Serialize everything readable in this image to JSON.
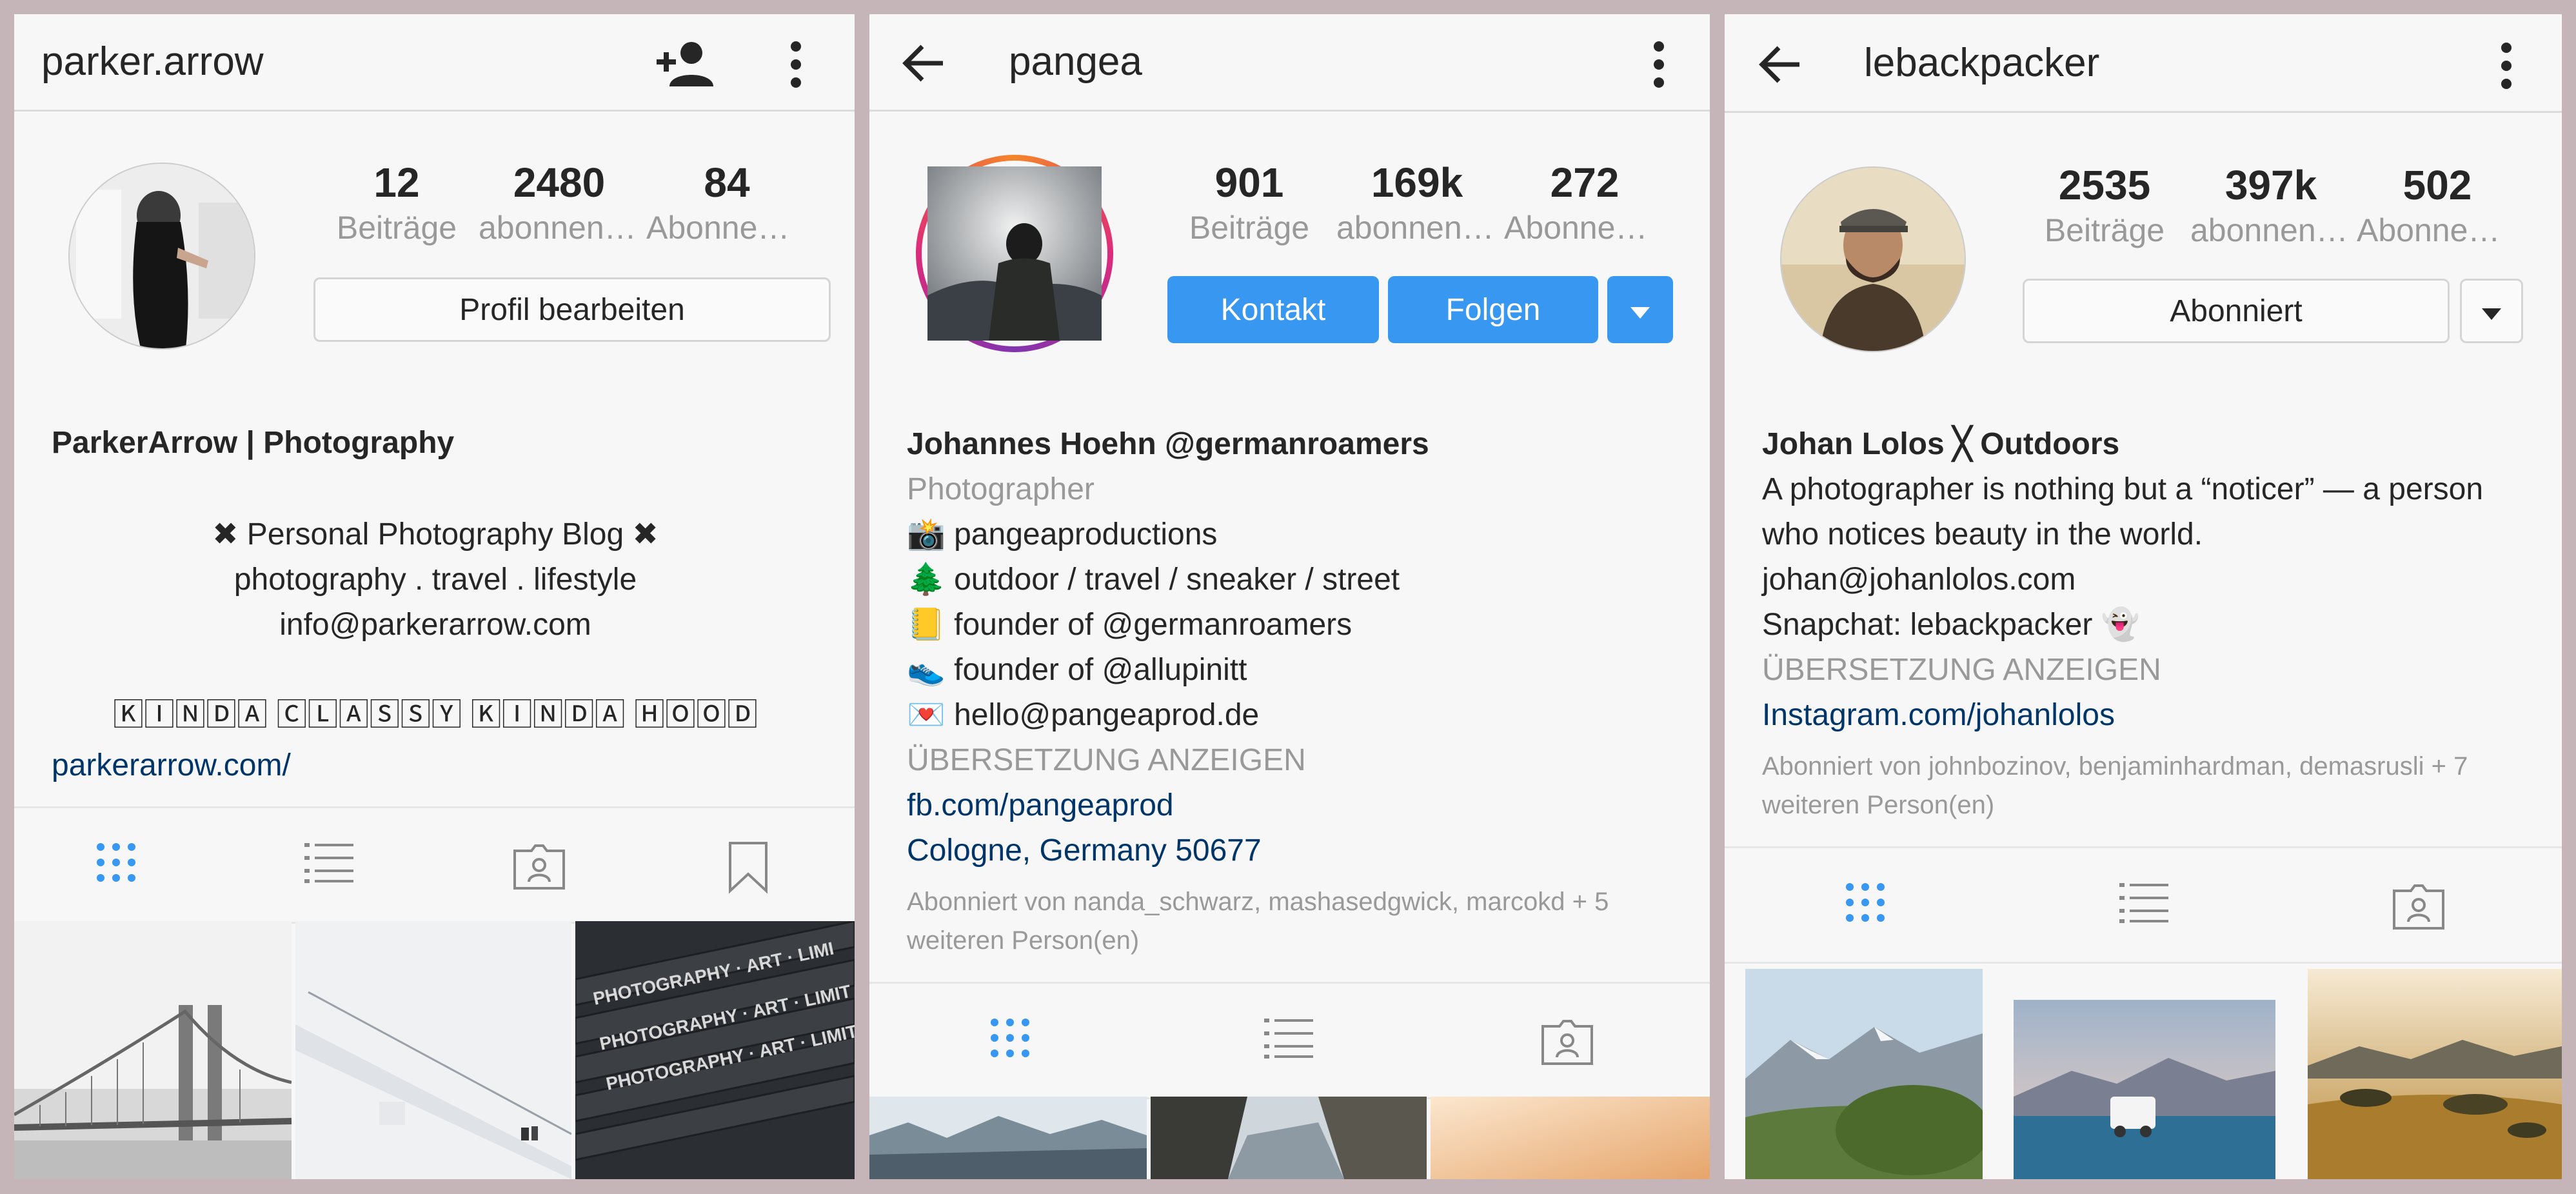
{
  "panels": [
    {
      "username": "parker.arrow",
      "stats": [
        {
          "num": "12",
          "label": "Beiträge"
        },
        {
          "num": "2480",
          "label": "abonnent..."
        },
        {
          "num": "84",
          "label": "Abonnem..."
        }
      ],
      "edit_button": "Profil bearbeiten",
      "bio_name": "ParkerArrow | Photography",
      "bio_lines": [
        "✖ Personal Photography Blog ✖",
        "photography . travel . lifestyle",
        "info@parkerarrow.com"
      ],
      "bio_tagline": "🄺🄸🄽🄳🄰 🄲🄻🄰🅂🅂🅈 🄺🄸🄽🄳🄰 🄷🄾🄾🄳",
      "link": "parkerarrow.com/",
      "icons": [
        "add-person-icon",
        "more-vertical-icon",
        "grid-icon",
        "list-icon",
        "tagged-icon",
        "bookmark-icon"
      ]
    },
    {
      "username": "pangea",
      "stats": [
        {
          "num": "901",
          "label": "Beiträge"
        },
        {
          "num": "169k",
          "label": "abonnent..."
        },
        {
          "num": "272",
          "label": "Abonnem..."
        }
      ],
      "contact_button": "Kontakt",
      "follow_button": "Folgen",
      "bio_name": "Johannes Hoehn @germanroamers",
      "category": "Photographer",
      "bio_lines": [
        "📸 pangeaproductions",
        "🌲 outdoor / travel / sneaker / street",
        "📒 founder of @germanroamers",
        "👟 founder of @allupinitt",
        "💌 hello@pangeaprod.de"
      ],
      "translate": "ÜBERSETZUNG ANZEIGEN",
      "link": "fb.com/pangeaprod",
      "location": "Cologne, Germany 50677",
      "followed_by": "Abonniert von nanda_schwarz, mashasedgwick, marcokd + 5 weiteren Person(en)"
    },
    {
      "username": "lebackpacker",
      "stats": [
        {
          "num": "2535",
          "label": "Beiträge"
        },
        {
          "num": "397k",
          "label": "abonnent..."
        },
        {
          "num": "502",
          "label": "Abonnem..."
        }
      ],
      "subscribed_button": "Abonniert",
      "bio_name": "Johan Lolos ╳ Outdoors",
      "bio_lines": [
        "A photographer is nothing but a “noticer” — a person who notices beauty in the world.",
        "johan@johanlolos.com",
        "Snapchat: lebackpacker 👻"
      ],
      "translate": "ÜBERSETZUNG ANZEIGEN",
      "link": "Instagram.com/johanlolos",
      "followed_by": "Abonniert von johnbozinov, benjaminhardman, demasrusli + 7 weiteren Person(en)"
    }
  ],
  "colors": {
    "accent": "#3897f0",
    "link": "#003569",
    "muted": "#999999",
    "border": "#dbdbdb"
  }
}
